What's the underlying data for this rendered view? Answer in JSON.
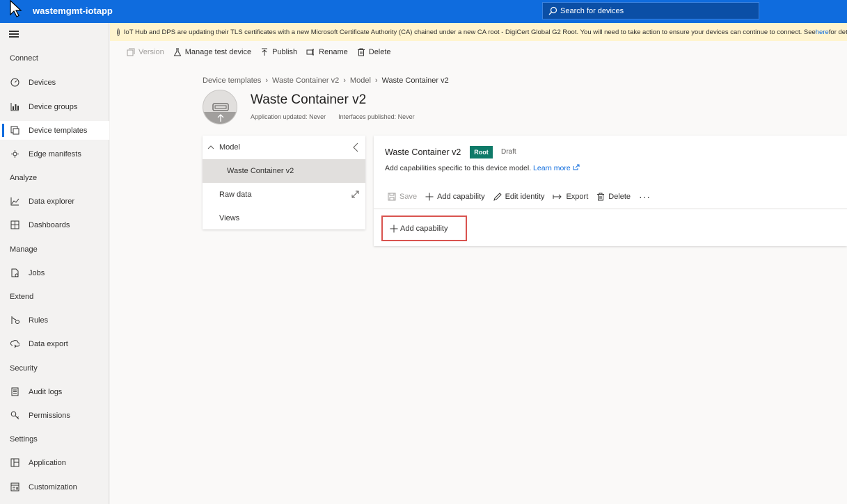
{
  "header": {
    "app_title": "wastemgmt-iotapp",
    "search_placeholder": "Search for devices",
    "color": "#0f6cde"
  },
  "sidebar": {
    "sections": [
      {
        "title": "Connect",
        "items": [
          {
            "label": "Devices",
            "icon": "devices-icon"
          },
          {
            "label": "Device groups",
            "icon": "device-groups-icon"
          },
          {
            "label": "Device templates",
            "icon": "device-templates-icon",
            "active": true
          },
          {
            "label": "Edge manifests",
            "icon": "edge-manifests-icon"
          }
        ]
      },
      {
        "title": "Analyze",
        "items": [
          {
            "label": "Data explorer",
            "icon": "data-explorer-icon"
          },
          {
            "label": "Dashboards",
            "icon": "dashboards-icon"
          }
        ]
      },
      {
        "title": "Manage",
        "items": [
          {
            "label": "Jobs",
            "icon": "jobs-icon"
          }
        ]
      },
      {
        "title": "Extend",
        "items": [
          {
            "label": "Rules",
            "icon": "rules-icon"
          },
          {
            "label": "Data export",
            "icon": "data-export-icon"
          }
        ]
      },
      {
        "title": "Security",
        "items": [
          {
            "label": "Audit logs",
            "icon": "audit-logs-icon"
          },
          {
            "label": "Permissions",
            "icon": "permissions-icon"
          }
        ]
      },
      {
        "title": "Settings",
        "items": [
          {
            "label": "Application",
            "icon": "application-icon"
          },
          {
            "label": "Customization",
            "icon": "customization-icon"
          }
        ]
      }
    ]
  },
  "banner": {
    "text": "IoT Hub and DPS are updating their TLS certificates with a new Microsoft Certificate Authority (CA) chained under a new CA root - DigiCert Global G2 Root. You will need to take action to ensure your devices can continue to connect. See ",
    "link": "here",
    "tail": " for detail"
  },
  "toolbar": {
    "version": "Version",
    "manage_test_device": "Manage test device",
    "publish": "Publish",
    "rename": "Rename",
    "delete": "Delete"
  },
  "breadcrumb": [
    "Device templates",
    "Waste Container v2",
    "Model",
    "Waste Container v2"
  ],
  "template": {
    "title": "Waste Container v2",
    "app_updated": "Application updated: Never",
    "interfaces_published": "Interfaces published: Never"
  },
  "model_panel": {
    "model_label": "Model",
    "selected_item": "Waste Container v2",
    "raw_data": "Raw data",
    "views": "Views"
  },
  "editor": {
    "title": "Waste Container v2",
    "badge": "Root",
    "status": "Draft",
    "description": "Add capabilities specific to this device model.",
    "learn_more": "Learn more",
    "save": "Save",
    "add_capability": "Add capability",
    "edit_identity": "Edit identity",
    "export": "Export",
    "delete": "Delete",
    "more": "···",
    "add_capability_button": "Add capability"
  }
}
